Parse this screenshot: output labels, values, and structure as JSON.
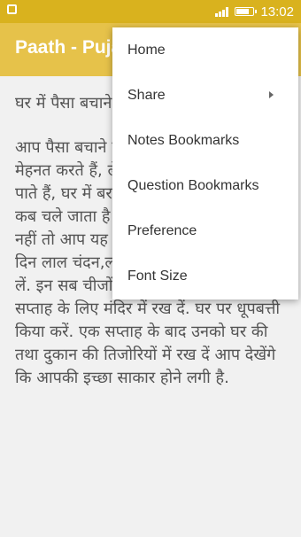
{
  "status_bar": {
    "time": "13:02"
  },
  "app_bar": {
    "title": "Paath - Puja"
  },
  "content": {
    "heading": "घर में पैसा बचाने के लिए",
    "body": "आप पैसा बचाने के लिए अधिक से अधिक मेहनत करते हैं, लेकिन फिर भी कुछ बचा नहीं पाते हैं, घर में बरकत नहीं होती है, पैसा आता है कब चले जाता है पता नहीं चलता, तो किताब नहीं तो आप यह उपाय आजमायें-मंगलवार के दिन लाल चंदन,लाल गुलाब के फूल तथा रोली लें. इन सब चीजों को लाल कपड़े में बांधकर एक सप्ताह के लिए मंदिर में रख दें. घर पर धूपबत्ती किया करें. एक सप्ताह के बाद उनको घर की तथा दुकान की तिजोरियों में रख दें आप देखेंगे कि आपकी इच्छा साकार होने लगी है."
  },
  "menu": {
    "items": [
      {
        "label": "Home"
      },
      {
        "label": "Share",
        "has_submenu": true
      },
      {
        "label": "Notes Bookmarks"
      },
      {
        "label": "Question Bookmarks"
      },
      {
        "label": "Preference"
      },
      {
        "label": "Font Size"
      }
    ]
  },
  "colors": {
    "status_bar": "#d9b21e",
    "app_bar": "#e6c24a",
    "background": "#f1f1f1",
    "text": "#555555"
  },
  "icons": [
    "notification-icon",
    "signal-icon",
    "battery-icon",
    "chevron-right-icon"
  ]
}
